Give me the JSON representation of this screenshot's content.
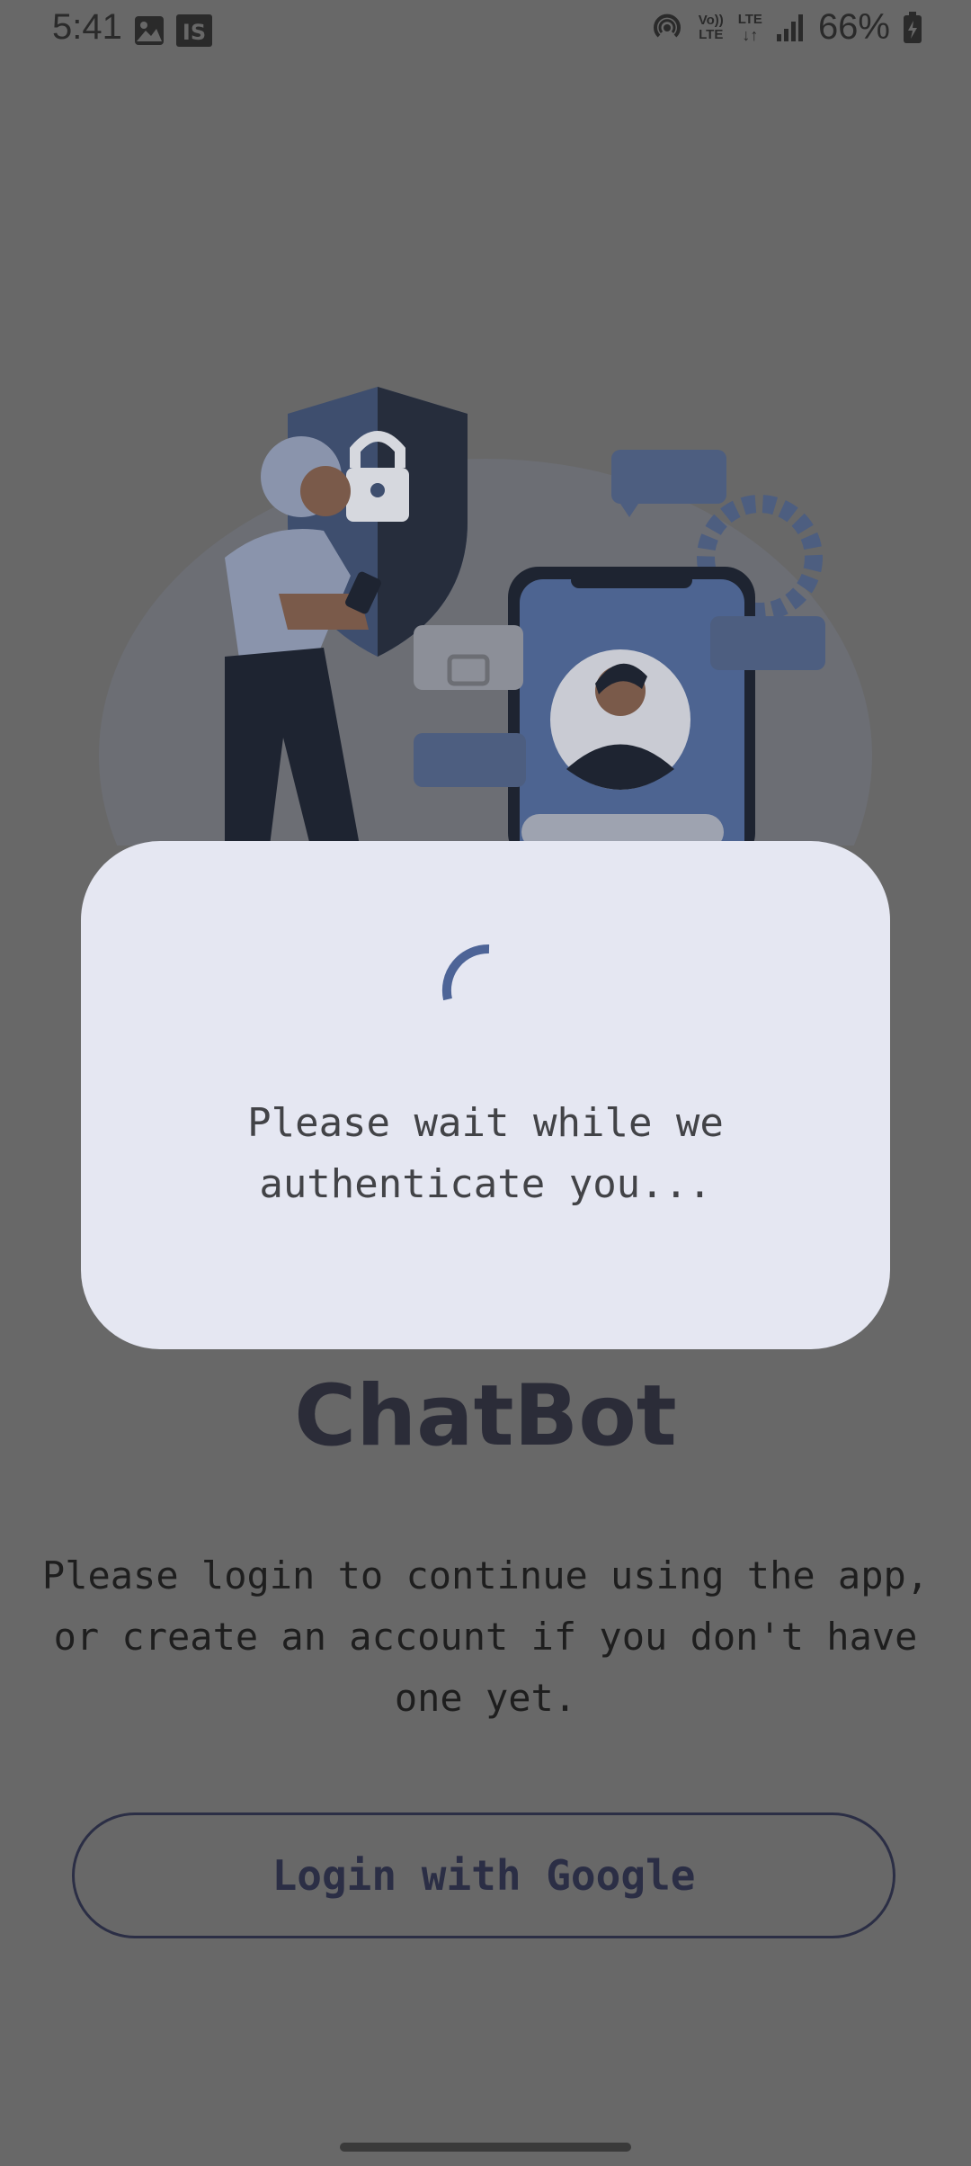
{
  "status_bar": {
    "time": "5:41",
    "battery_percent": "66%",
    "network_label_top": "Vo)) LTE",
    "lte_label": "LTE",
    "icons": [
      "gallery-icon",
      "is-app-icon",
      "hotspot-icon",
      "volte-icon",
      "lte-data-icon",
      "signal-icon",
      "battery-charging-icon"
    ]
  },
  "dialog": {
    "message": "Please wait while we authenticate you...",
    "accent_color": "#4d6497"
  },
  "main": {
    "title": "ChatBot",
    "description": "Please login to continue using the app, or create an account if you don't have one yet.",
    "login_button_label": "Login with Google",
    "illustration": "security-login-illustration"
  },
  "colors": {
    "overlay": "#686868",
    "dialog_bg": "#e5e7f2",
    "title": "#2b2c38",
    "button_border": "#2b2e45"
  }
}
